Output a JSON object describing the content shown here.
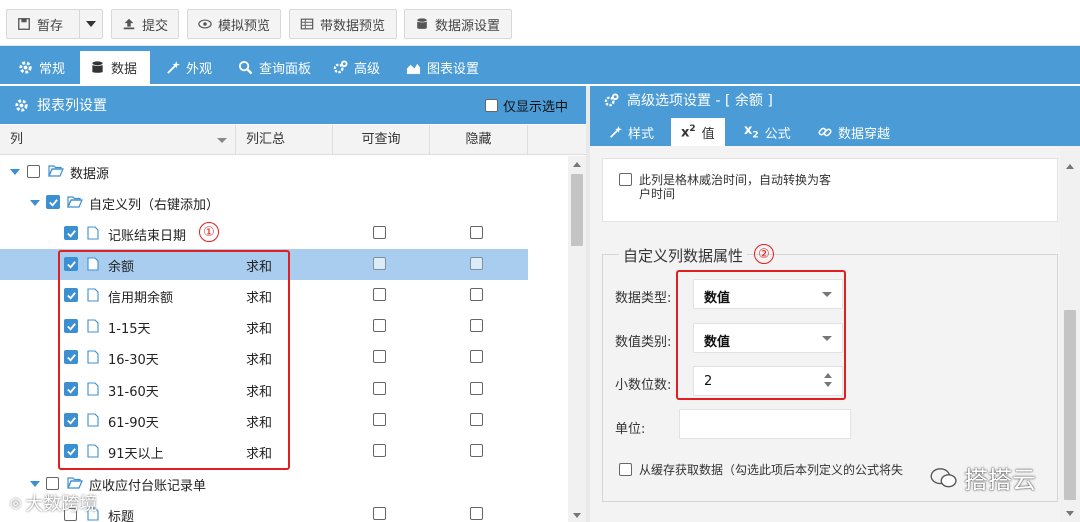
{
  "toolbar": {
    "save": "暂存",
    "submit": "提交",
    "mock_preview": "模拟预览",
    "data_preview": "带数据预览",
    "datasource_settings": "数据源设置"
  },
  "tabs": [
    "常规",
    "数据",
    "外观",
    "查询面板",
    "高级",
    "图表设置"
  ],
  "active_tab": "数据",
  "left_panel": {
    "title": "报表列设置",
    "only_selected": "仅显示选中",
    "columns": [
      "列",
      "列汇总",
      "可查询",
      "隐藏"
    ]
  },
  "tree": {
    "root": "数据源",
    "custom_group": "自定义列（右键添加）",
    "rows": [
      {
        "label": "记账结束日期",
        "summary": "",
        "checked": true
      },
      {
        "label": "余额",
        "summary": "求和",
        "checked": true
      },
      {
        "label": "信用期余额",
        "summary": "求和",
        "checked": true
      },
      {
        "label": "1-15天",
        "summary": "求和",
        "checked": true
      },
      {
        "label": "16-30天",
        "summary": "求和",
        "checked": true
      },
      {
        "label": "31-60天",
        "summary": "求和",
        "checked": true
      },
      {
        "label": "61-90天",
        "summary": "求和",
        "checked": true
      },
      {
        "label": "91天以上",
        "summary": "求和",
        "checked": true
      }
    ],
    "group2": "应收应付台账记录单",
    "group2_child": "标题"
  },
  "right_panel": {
    "title": "高级选项设置 - [ 余额 ]",
    "tabs": [
      "样式",
      "值",
      "公式",
      "数据穿越"
    ],
    "active_tab": "值",
    "greenwich_note_1": "此列是格林威治时间，自动转换为客",
    "greenwich_note_2": "户时间",
    "section_title": "自定义列数据属性",
    "data_type_label": "数据类型:",
    "data_type_value": "数值",
    "number_type_label": "数值类别:",
    "number_type_value": "数值",
    "decimals_label": "小数位数:",
    "decimals_value": "2",
    "unit_label": "单位:",
    "unit_value": "",
    "cache_note": "从缓存获取数据（勾选此项后本列定义的公式将失"
  },
  "annotations": {
    "one": "①",
    "two": "②"
  },
  "watermarks": {
    "left": "大数跨境",
    "right": "搭搭云"
  },
  "colors": {
    "accent": "#4a9bd6",
    "selected_row": "#a9cdee",
    "highlight": "#e02020"
  }
}
